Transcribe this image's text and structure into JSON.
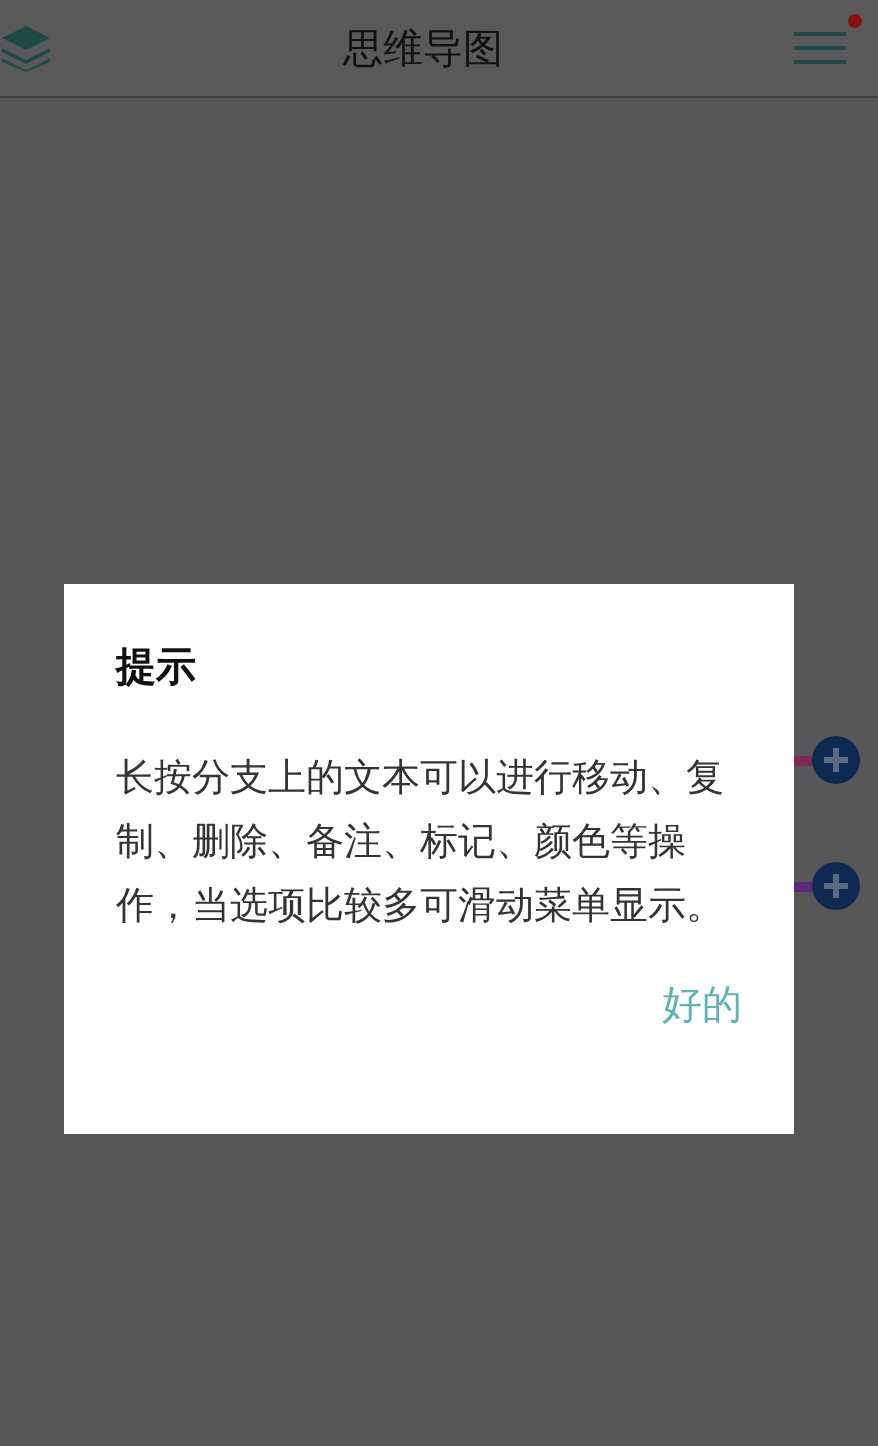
{
  "header": {
    "title": "思维导图",
    "notification": true
  },
  "branches": [
    {
      "color": "#7a2a55"
    },
    {
      "color": "#5a2a7a"
    }
  ],
  "dialog": {
    "title": "提示",
    "message": "长按分支上的文本可以进行移动、复制、删除、备注、标记、颜色等操作，当选项比较多可滑动菜单显示。",
    "button": "好的"
  }
}
